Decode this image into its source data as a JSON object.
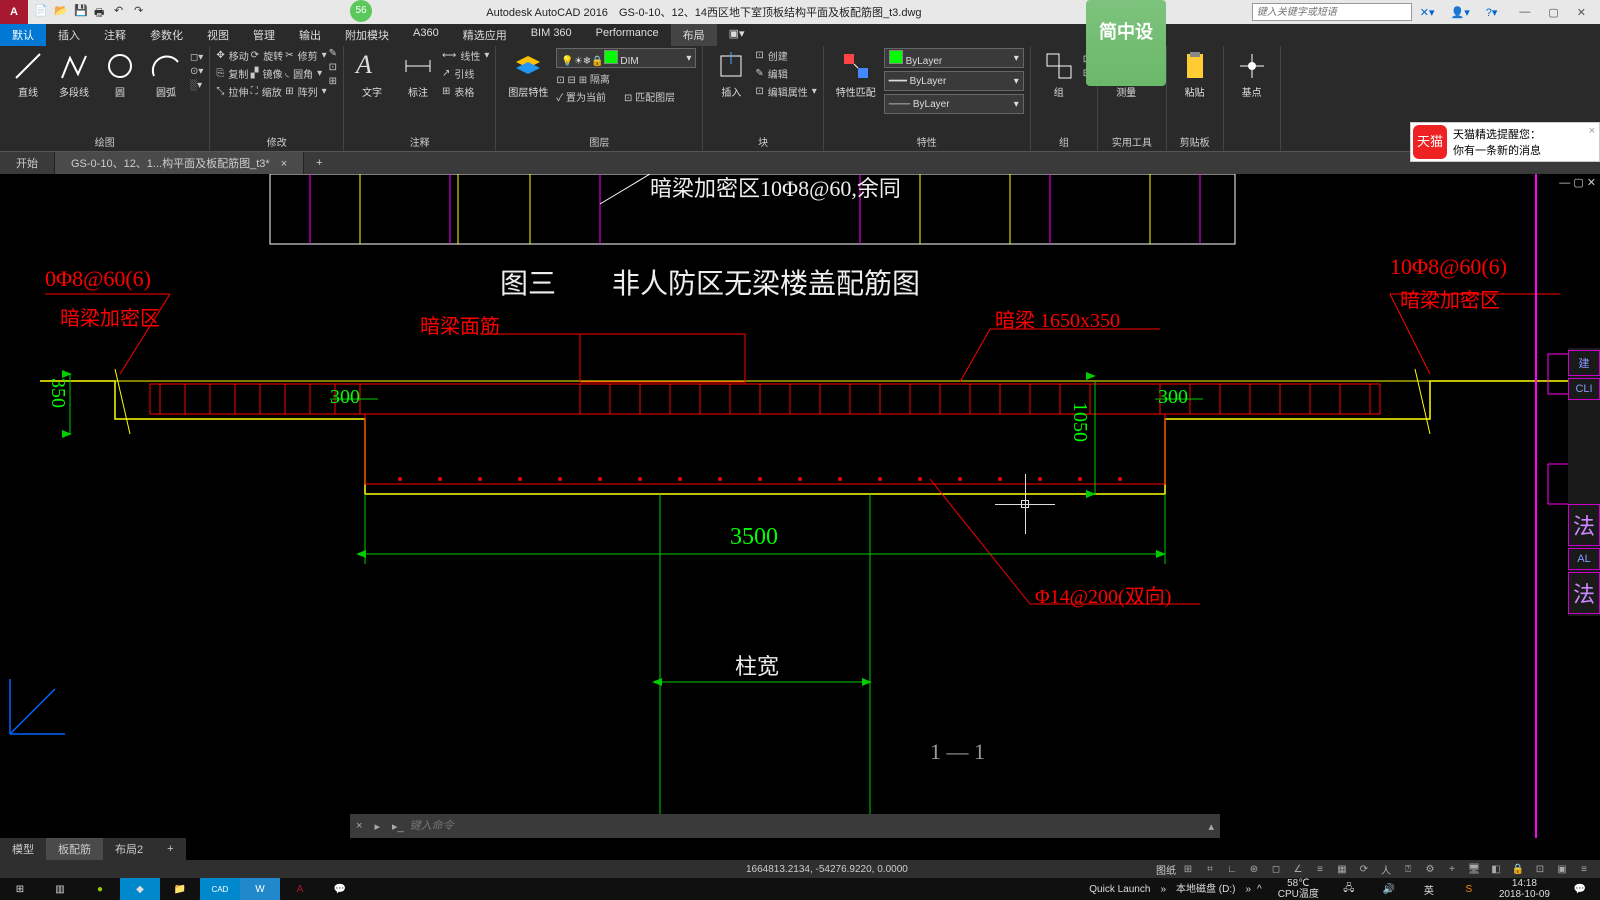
{
  "app": {
    "title_prefix": "Autodesk AutoCAD 2016",
    "filename": "GS-0-10、12、14西区地下室顶板结构平面及板配筋图_t3.dwg",
    "search_placeholder": "键入关键字或短语",
    "badge_count": "56"
  },
  "menu": [
    "默认",
    "插入",
    "注释",
    "参数化",
    "视图",
    "管理",
    "输出",
    "附加模块",
    "A360",
    "精选应用",
    "BIM 360",
    "Performance",
    "布局"
  ],
  "ribbon": {
    "draw": {
      "title": "绘图",
      "line": "直线",
      "polyline": "多段线",
      "circle": "圆",
      "arc": "圆弧"
    },
    "modify": {
      "title": "修改",
      "move": "移动",
      "rotate": "旋转",
      "trim": "修剪",
      "copy": "复制",
      "mirror": "镜像",
      "fillet": "圆角",
      "stretch": "拉伸",
      "scale": "缩放",
      "array": "阵列"
    },
    "annot": {
      "title": "注释",
      "text": "文字",
      "dim": "标注",
      "table": "表格",
      "lead": "引线",
      "lin": "线性"
    },
    "layer": {
      "title": "图层",
      "props": "图层特性",
      "dim_layer": "DIM",
      "iso": "隔离",
      "set": "置为当前",
      "match": "匹配图层"
    },
    "block": {
      "title": "块",
      "insert": "插入",
      "create": "创建",
      "edit": "编辑",
      "editattr": "编辑属性"
    },
    "props": {
      "title": "特性",
      "match": "特性匹配",
      "bylayer": "ByLayer"
    },
    "group": {
      "title": "组",
      "group": "组"
    },
    "util": {
      "title": "实用工具",
      "measure": "测量"
    },
    "clip": {
      "title": "剪贴板",
      "paste": "粘贴"
    },
    "base": {
      "title": "基点"
    }
  },
  "brand": "简中设",
  "notif": {
    "title": "天猫精选提醒您：",
    "body": "你有一条新的消息",
    "app": "天猫"
  },
  "tabs": {
    "start": "开始",
    "file": "GS-0-10、12、1...构平面及板配筋图_t3*"
  },
  "drawing": {
    "top_note": "暗梁加密区10Φ8@60,余同",
    "title": "图三　　非人防区无梁楼盖配筋图",
    "left_label1": "0Φ8@60(6)",
    "left_label2": "暗梁加密区",
    "right_label1": "10Φ8@60(6)",
    "right_label2": "暗梁加密区",
    "face_rebar": "暗梁面筋",
    "beam_size": "暗梁 1650x350",
    "dim_350": "350",
    "dim_300a": "300",
    "dim_300b": "300",
    "dim_1050": "1050",
    "dim_3500": "3500",
    "col_width": "柱宽",
    "rebar_spec": "Φ14@200(双向)",
    "section": "1 — 1"
  },
  "cmd": {
    "placeholder": "键入命令"
  },
  "layouts": [
    "模型",
    "板配筋",
    "布局2",
    "+"
  ],
  "status": {
    "coords": "1664813.2134, -54276.9220, 0.0000",
    "paper": "图纸"
  },
  "taskbar": {
    "quick": "Quick Launch",
    "disk": "本地磁盘 (D:)",
    "temp1": "58℃",
    "temp2": "CPU温度",
    "time": "14:18",
    "date": "2018-10-09"
  },
  "side": [
    "建",
    "CLI",
    "",
    "法",
    "AL",
    "法"
  ]
}
